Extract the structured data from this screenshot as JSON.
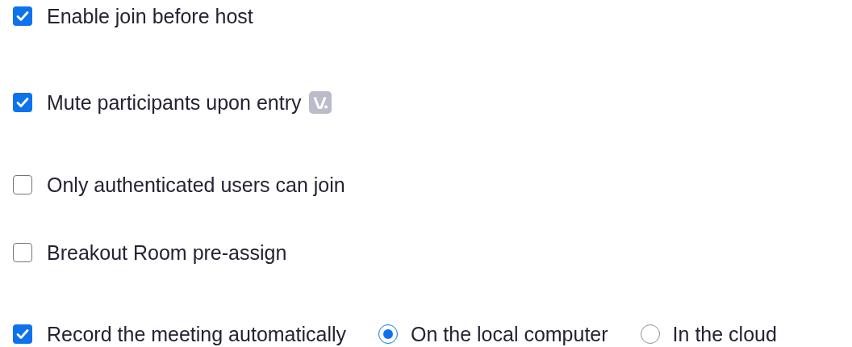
{
  "settings": [
    {
      "label": "Enable join before host",
      "checked": true
    },
    {
      "label": "Mute participants upon entry",
      "checked": true,
      "badge": true
    },
    {
      "label": "Only authenticated users can join",
      "checked": false
    },
    {
      "label": "Breakout Room pre-assign",
      "checked": false
    },
    {
      "label": "Record the meeting automatically",
      "checked": true,
      "options": [
        {
          "label": "On the local computer",
          "selected": true
        },
        {
          "label": "In the cloud",
          "selected": false
        }
      ]
    }
  ]
}
